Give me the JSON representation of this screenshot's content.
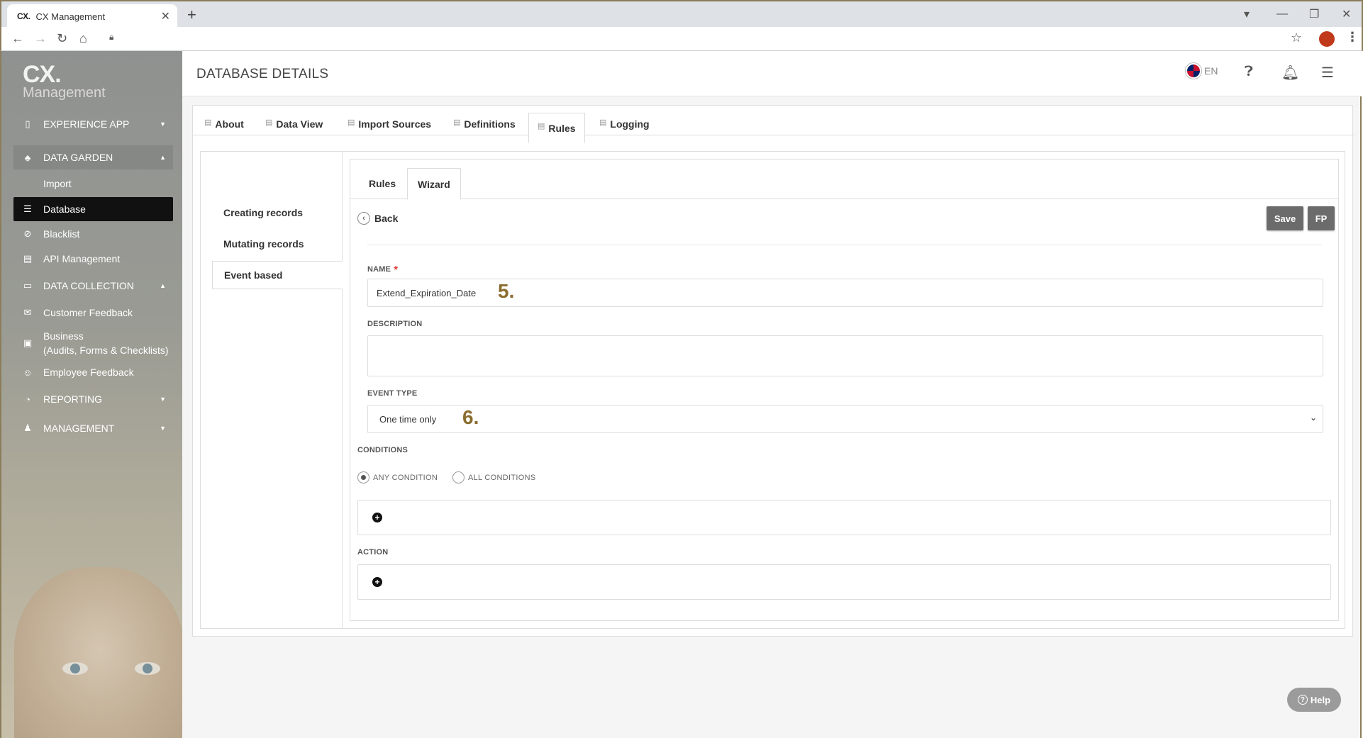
{
  "browser": {
    "tab_favicon": "CX.",
    "tab_title": "CX Management",
    "tab_close": "✕",
    "new_tab": "+",
    "icons": [
      "back-arrow-icon",
      "forward-arrow-icon",
      "reload-icon",
      "home-icon",
      "lock-icon",
      "star-icon",
      "kebab-icon"
    ]
  },
  "sidebar": {
    "logo_main": "CX.",
    "logo_sub": "Management",
    "items": [
      {
        "label": "EXPERIENCE APP",
        "icon": "phone-icon",
        "type": "group"
      },
      {
        "label": "DATA GARDEN",
        "icon": "tree-icon",
        "type": "group-open"
      },
      {
        "label": "Import",
        "icon": "",
        "type": "sub"
      },
      {
        "label": "Database",
        "icon": "database-icon",
        "type": "sub-active"
      },
      {
        "label": "Blacklist",
        "icon": "ban-icon",
        "type": "sub"
      },
      {
        "label": "API Management",
        "icon": "file-icon",
        "type": "sub"
      },
      {
        "label": "DATA COLLECTION",
        "icon": "inbox-icon",
        "type": "group-open"
      },
      {
        "label": "Customer Feedback",
        "icon": "chat-icon",
        "type": "sub"
      },
      {
        "label": "Business",
        "label2": "(Audits, Forms & Checklists)",
        "icon": "briefcase-icon",
        "type": "sub"
      },
      {
        "label": "Employee Feedback",
        "icon": "users-icon",
        "type": "sub"
      },
      {
        "label": "REPORTING",
        "icon": "pie-chart-icon",
        "type": "group"
      },
      {
        "label": "MANAGEMENT",
        "icon": "user-icon",
        "type": "group"
      }
    ]
  },
  "header": {
    "title": "DATABASE DETAILS",
    "language": "EN"
  },
  "tabs": [
    {
      "label": "About"
    },
    {
      "label": "Data View"
    },
    {
      "label": "Import Sources"
    },
    {
      "label": "Definitions"
    },
    {
      "label": "Rules",
      "active": true
    },
    {
      "label": "Logging"
    }
  ],
  "left_nav": [
    {
      "label": "Creating records"
    },
    {
      "label": "Mutating records"
    },
    {
      "label": "Event based",
      "active": true
    }
  ],
  "subtabs": [
    {
      "label": "Rules"
    },
    {
      "label": "Wizard",
      "active": true
    }
  ],
  "form": {
    "back_label": "Back",
    "save_label": "Save",
    "fp_label": "FP",
    "name_label": "NAME",
    "name_required": "*",
    "name_value": "Extend_Expiration_Date",
    "name_step": "5.",
    "description_label": "DESCRIPTION",
    "description_value": "",
    "event_type_label": "EVENT TYPE",
    "event_type_value": "One time only",
    "event_type_step": "6.",
    "conditions_label": "CONDITIONS",
    "radio_any": "ANY CONDITION",
    "radio_all": "ALL CONDITIONS",
    "radio_selected": "any",
    "action_label": "ACTION"
  },
  "help": {
    "label": "Help"
  },
  "colors": {
    "sidebar_active": "#111111",
    "button": "#6b6b6b",
    "step_number": "#8a6d2f",
    "required": "#e03a3a"
  }
}
